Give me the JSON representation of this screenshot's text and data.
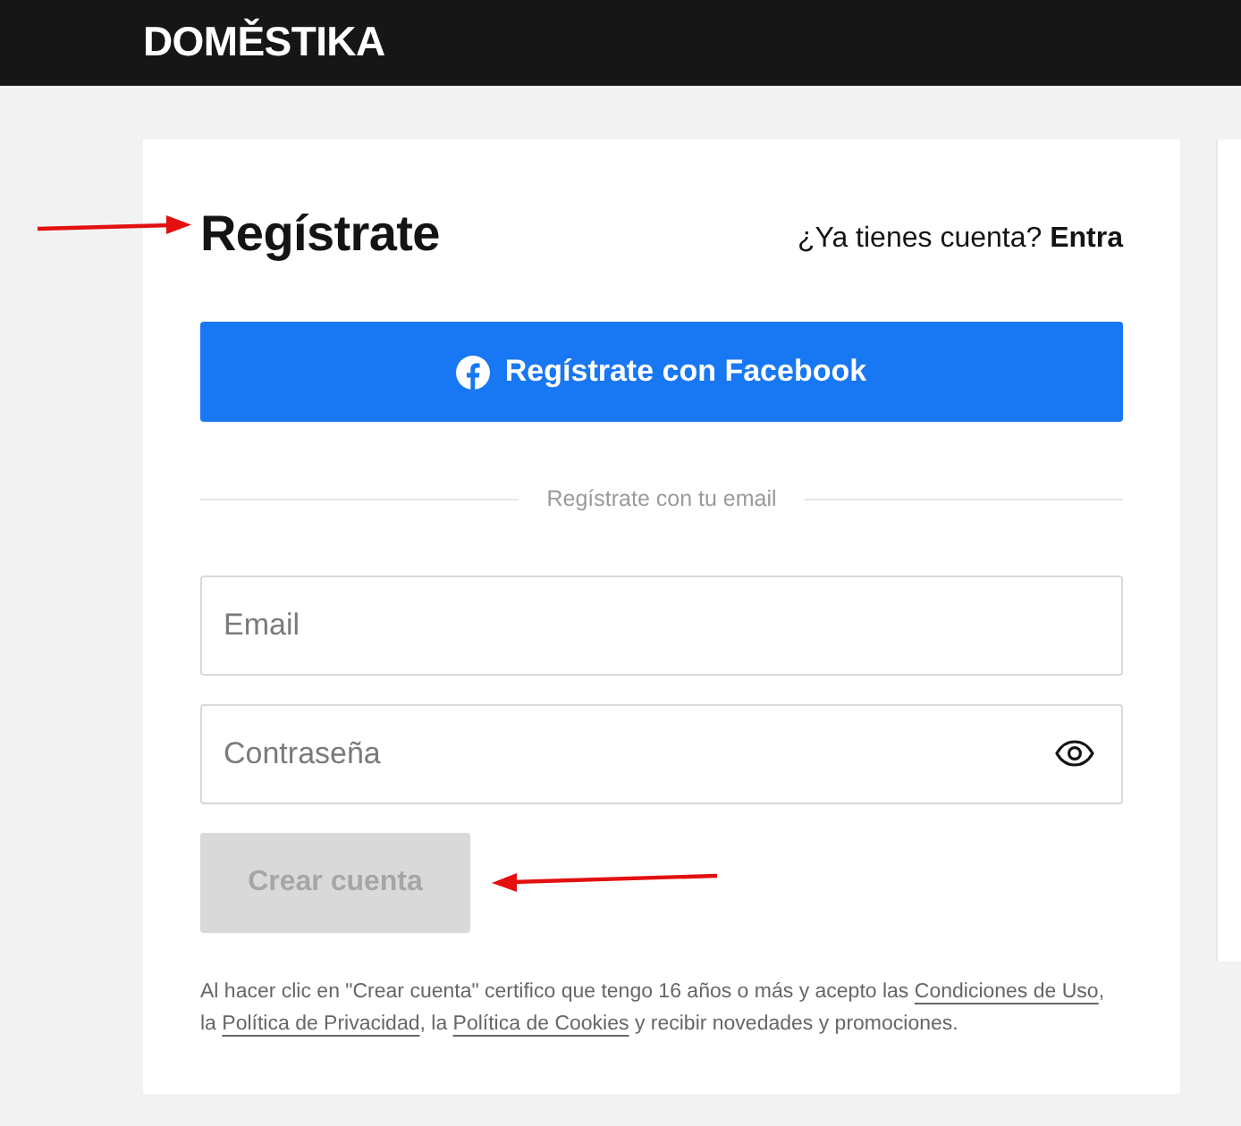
{
  "header": {
    "logo": "DOMĚSTIKA"
  },
  "form": {
    "title": {
      "text": "Regístrate",
      "arrow_marked": true
    },
    "login_prompt": "¿Ya tienes cuenta?",
    "login_link": "Entra",
    "facebook_button": "Regístrate con Facebook",
    "divider_text": "Regístrate con tu email",
    "fields": [
      {
        "kind": "text",
        "placeholder": "Email"
      },
      {
        "kind": "password",
        "placeholder": "Contraseña"
      }
    ],
    "submit": {
      "label": "Crear cuenta",
      "disabled": true,
      "arrow_marked": true
    },
    "legal": [
      {
        "kind": "text",
        "text": "Al hacer clic en \"Crear cuenta\" certifico que tengo 16 años o más y acepto las "
      },
      {
        "kind": "link",
        "text": "Condiciones de Uso"
      },
      {
        "kind": "text",
        "text": ", la "
      },
      {
        "kind": "link",
        "text": "Política de Privacidad"
      },
      {
        "kind": "text",
        "text": ", la "
      },
      {
        "kind": "link",
        "text": "Política de Cookies"
      },
      {
        "kind": "text",
        "text": " y recibir novedades y promociones."
      }
    ]
  }
}
